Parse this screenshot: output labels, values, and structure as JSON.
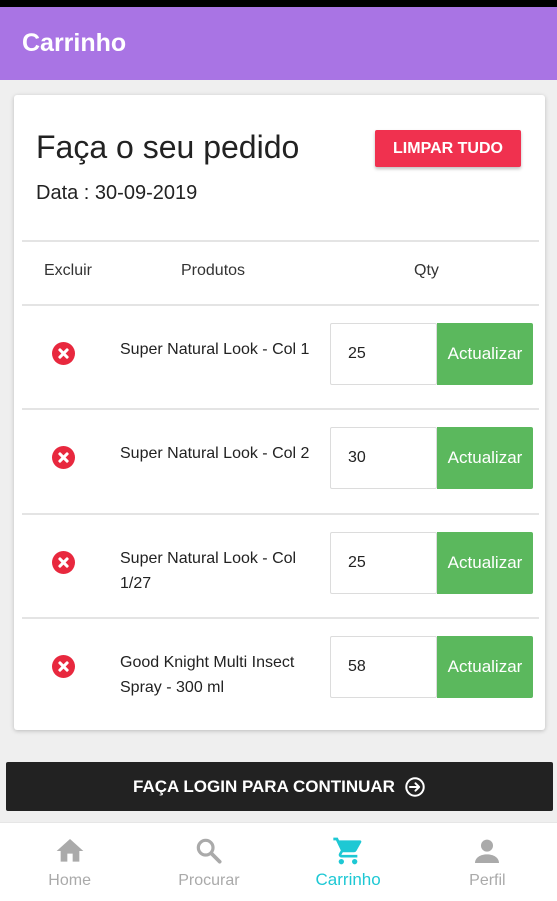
{
  "app": {
    "title": "Carrinho"
  },
  "order": {
    "title": "Faça o seu pedido",
    "date": "Data : 30-09-2019",
    "clear_all_label": "LIMPAR TUDO"
  },
  "table": {
    "headers": {
      "remove": "Excluir",
      "products": "Produtos",
      "qty": "Qty"
    },
    "rows": [
      {
        "name": "Super Natural Look - Col 1",
        "qty": "25",
        "update_label": "Actualizar"
      },
      {
        "name": "Super Natural Look - Col 2",
        "qty": "30",
        "update_label": "Actualizar"
      },
      {
        "name": "Super Natural Look - Col 1/27",
        "qty": "25",
        "update_label": "Actualizar"
      },
      {
        "name": "Good Knight Multi Insect Spray - 300 ml",
        "qty": "58",
        "update_label": "Actualizar"
      }
    ]
  },
  "login_button": {
    "label": "FAÇA LOGIN PARA CONTINUAR",
    "icon": "arrow-circle-right-icon"
  },
  "bottom_nav": {
    "items": [
      {
        "label": "Home",
        "icon": "home-icon",
        "active": false
      },
      {
        "label": "Procurar",
        "icon": "search-icon",
        "active": false
      },
      {
        "label": "Carrinho",
        "icon": "cart-icon",
        "active": true
      },
      {
        "label": "Perfil",
        "icon": "person-icon",
        "active": false
      }
    ]
  },
  "colors": {
    "appbar": "#a974e4",
    "clear_button": "#f0314f",
    "remove_icon": "#e8283e",
    "update_button": "#5bb85d",
    "login_button": "#222222",
    "nav_active": "#1ec8d4",
    "nav_inactive": "#aaaaaa"
  }
}
